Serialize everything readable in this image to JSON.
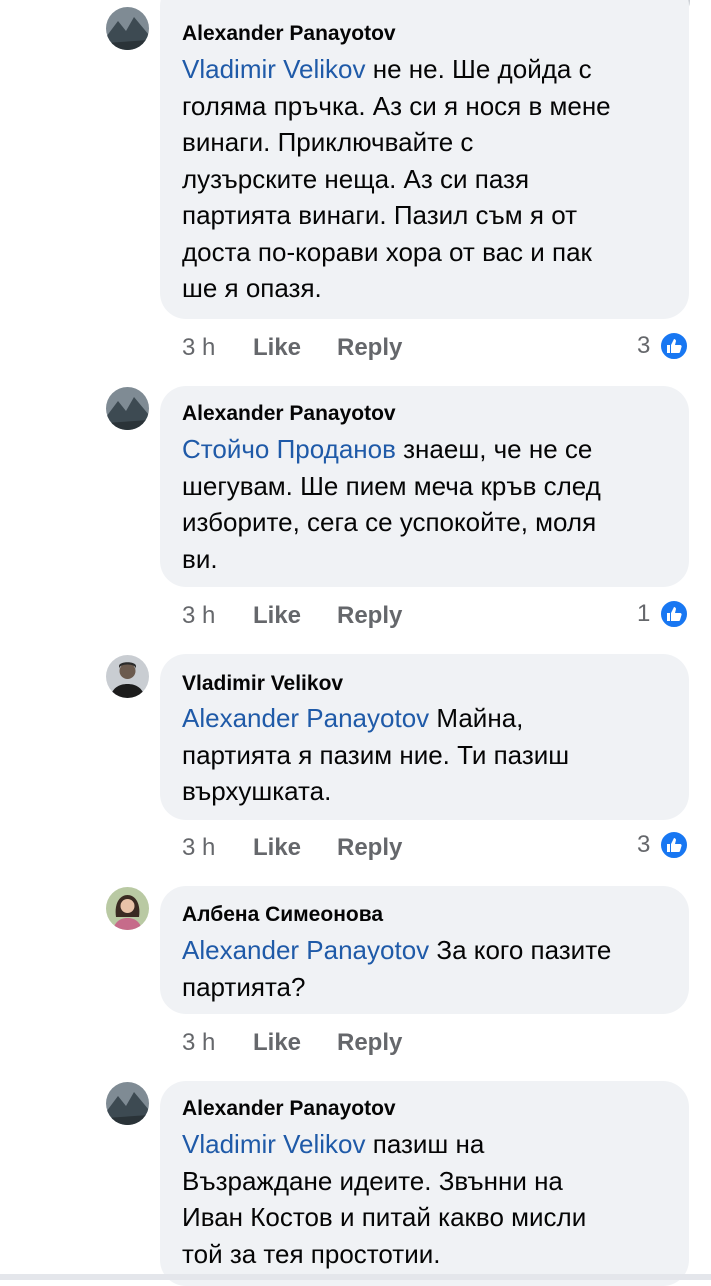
{
  "comments": [
    {
      "author": "Alexander Panayotov",
      "mention": "Vladimir Velikov",
      "line1_rest": " не не. Ше дойда с",
      "lines": [
        "голяма пръчка. Аз си я нося в мене",
        "винаги. Приключвайте с",
        "лузърските неща. Аз си пазя",
        "партията винаги. Пазил съм я от",
        "доста по-корави хора от вас и пак",
        "ше я опазя."
      ],
      "time": "3 h",
      "like": "Like",
      "reply": "Reply",
      "reactions": "3",
      "avatar_icon": "mountain-avatar-icon"
    },
    {
      "author": "Alexander Panayotov",
      "mention": "Стойчо Проданов",
      "line1_rest": " знаеш, че не се",
      "lines": [
        "шегувам. Ше пием меча кръв след",
        "изборите, сега се успокойте, моля",
        "ви."
      ],
      "time": "3 h",
      "like": "Like",
      "reply": "Reply",
      "reactions": "1",
      "avatar_icon": "mountain-avatar-icon"
    },
    {
      "author": "Vladimir Velikov",
      "mention": "Alexander Panayotov",
      "line1_rest": " Майна,",
      "lines": [
        "партията я пазим ние. Ти пазиш",
        "върхушката."
      ],
      "time": "3 h",
      "like": "Like",
      "reply": "Reply",
      "reactions": "3",
      "avatar_icon": "person-avatar-icon"
    },
    {
      "author": "Албена Симеонова",
      "mention": "Alexander Panayotov",
      "line1_rest": " За кого пазите",
      "lines": [
        "партията?"
      ],
      "time": "3 h",
      "like": "Like",
      "reply": "Reply",
      "avatar_icon": "woman-avatar-icon"
    },
    {
      "author": "Alexander Panayotov",
      "mention": "Vladimir Velikov",
      "line1_rest": " пазиш на",
      "lines": [
        "Възраждане идеите. Звънни на",
        "Иван Костов и питай какво мисли",
        "той за тея простотии."
      ],
      "avatar_icon": "mountain-avatar-icon"
    }
  ],
  "colors": {
    "bubble": "#f0f2f5",
    "mention": "#1f5aa8",
    "meta": "#65676b",
    "like_badge": "#1877f2"
  }
}
